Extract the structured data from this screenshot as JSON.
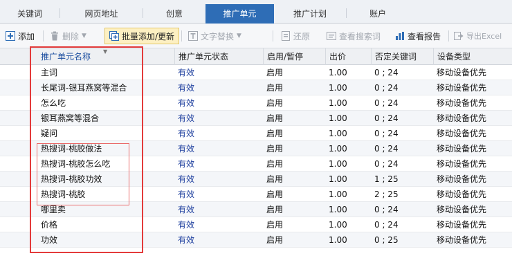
{
  "tabs": [
    {
      "label": "关键词",
      "active": false
    },
    {
      "label": "网页地址",
      "active": false
    },
    {
      "label": "创意",
      "active": false
    },
    {
      "label": "推广单元",
      "active": true
    },
    {
      "label": "推广计划",
      "active": false
    },
    {
      "label": "账户",
      "active": false
    }
  ],
  "toolbar": {
    "add": "添加",
    "delete": "删除",
    "batch_add": "批量添加/更新",
    "text_replace": "文字替换",
    "restore": "还原",
    "view_search_terms": "查看搜索词",
    "view_report": "查看报告",
    "export_excel": "导出Excel"
  },
  "colors": {
    "active_tab": "#2e6db6",
    "status_text": "#1e3f9e",
    "annotation_red": "#e33b3b",
    "highlight_button": "#fdf0c2",
    "add_icon": "#2e6db6",
    "report_icon": "#2e6db6"
  },
  "table": {
    "headers": {
      "name": "推广单元名称",
      "status": "推广单元状态",
      "enable": "启用/暂停",
      "bid": "出价",
      "neg_kw": "否定关键词",
      "device": "设备类型"
    },
    "rows": [
      {
        "name": "主词",
        "status": "有效",
        "enable": "启用",
        "bid": "1.00",
        "neg_kw": "0 ; 24",
        "device": "移动设备优先"
      },
      {
        "name": "长尾词-银耳燕窝等混合",
        "status": "有效",
        "enable": "启用",
        "bid": "1.00",
        "neg_kw": "0 ; 24",
        "device": "移动设备优先"
      },
      {
        "name": "怎么吃",
        "status": "有效",
        "enable": "启用",
        "bid": "1.00",
        "neg_kw": "0 ; 24",
        "device": "移动设备优先"
      },
      {
        "name": "银耳燕窝等混合",
        "status": "有效",
        "enable": "启用",
        "bid": "1.00",
        "neg_kw": "0 ; 24",
        "device": "移动设备优先"
      },
      {
        "name": "疑问",
        "status": "有效",
        "enable": "启用",
        "bid": "1.00",
        "neg_kw": "0 ; 24",
        "device": "移动设备优先"
      },
      {
        "name": "热搜词-桃胶做法",
        "status": "有效",
        "enable": "启用",
        "bid": "1.00",
        "neg_kw": "0 ; 24",
        "device": "移动设备优先"
      },
      {
        "name": "热搜词-桃胶怎么吃",
        "status": "有效",
        "enable": "启用",
        "bid": "1.00",
        "neg_kw": "0 ; 24",
        "device": "移动设备优先"
      },
      {
        "name": "热搜词-桃胶功效",
        "status": "有效",
        "enable": "启用",
        "bid": "1.00",
        "neg_kw": "1 ; 25",
        "device": "移动设备优先"
      },
      {
        "name": "热搜词-桃胶",
        "status": "有效",
        "enable": "启用",
        "bid": "1.00",
        "neg_kw": "2 ; 25",
        "device": "移动设备优先"
      },
      {
        "name": "哪里卖",
        "status": "有效",
        "enable": "启用",
        "bid": "1.00",
        "neg_kw": "0 ; 24",
        "device": "移动设备优先"
      },
      {
        "name": "价格",
        "status": "有效",
        "enable": "启用",
        "bid": "1.00",
        "neg_kw": "0 ; 24",
        "device": "移动设备优先"
      },
      {
        "name": "功效",
        "status": "有效",
        "enable": "启用",
        "bid": "1.00",
        "neg_kw": "0 ; 25",
        "device": "移动设备优先"
      }
    ]
  }
}
